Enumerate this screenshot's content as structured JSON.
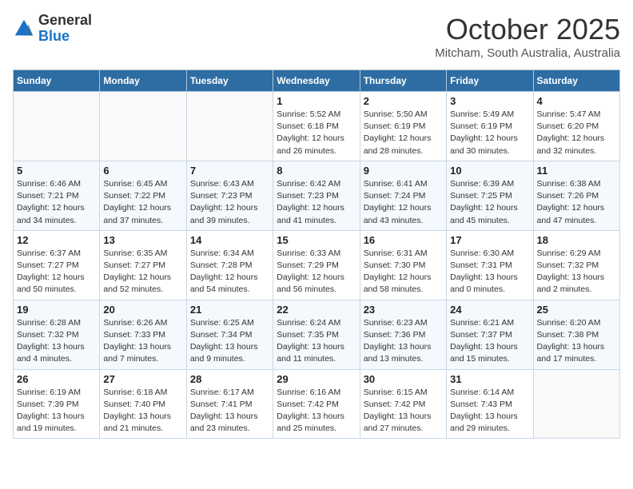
{
  "logo": {
    "general": "General",
    "blue": "Blue"
  },
  "title": "October 2025",
  "location": "Mitcham, South Australia, Australia",
  "days_of_week": [
    "Sunday",
    "Monday",
    "Tuesday",
    "Wednesday",
    "Thursday",
    "Friday",
    "Saturday"
  ],
  "weeks": [
    [
      {
        "day": "",
        "info": ""
      },
      {
        "day": "",
        "info": ""
      },
      {
        "day": "",
        "info": ""
      },
      {
        "day": "1",
        "info": "Sunrise: 5:52 AM\nSunset: 6:18 PM\nDaylight: 12 hours\nand 26 minutes."
      },
      {
        "day": "2",
        "info": "Sunrise: 5:50 AM\nSunset: 6:19 PM\nDaylight: 12 hours\nand 28 minutes."
      },
      {
        "day": "3",
        "info": "Sunrise: 5:49 AM\nSunset: 6:19 PM\nDaylight: 12 hours\nand 30 minutes."
      },
      {
        "day": "4",
        "info": "Sunrise: 5:47 AM\nSunset: 6:20 PM\nDaylight: 12 hours\nand 32 minutes."
      }
    ],
    [
      {
        "day": "5",
        "info": "Sunrise: 6:46 AM\nSunset: 7:21 PM\nDaylight: 12 hours\nand 34 minutes."
      },
      {
        "day": "6",
        "info": "Sunrise: 6:45 AM\nSunset: 7:22 PM\nDaylight: 12 hours\nand 37 minutes."
      },
      {
        "day": "7",
        "info": "Sunrise: 6:43 AM\nSunset: 7:23 PM\nDaylight: 12 hours\nand 39 minutes."
      },
      {
        "day": "8",
        "info": "Sunrise: 6:42 AM\nSunset: 7:23 PM\nDaylight: 12 hours\nand 41 minutes."
      },
      {
        "day": "9",
        "info": "Sunrise: 6:41 AM\nSunset: 7:24 PM\nDaylight: 12 hours\nand 43 minutes."
      },
      {
        "day": "10",
        "info": "Sunrise: 6:39 AM\nSunset: 7:25 PM\nDaylight: 12 hours\nand 45 minutes."
      },
      {
        "day": "11",
        "info": "Sunrise: 6:38 AM\nSunset: 7:26 PM\nDaylight: 12 hours\nand 47 minutes."
      }
    ],
    [
      {
        "day": "12",
        "info": "Sunrise: 6:37 AM\nSunset: 7:27 PM\nDaylight: 12 hours\nand 50 minutes."
      },
      {
        "day": "13",
        "info": "Sunrise: 6:35 AM\nSunset: 7:27 PM\nDaylight: 12 hours\nand 52 minutes."
      },
      {
        "day": "14",
        "info": "Sunrise: 6:34 AM\nSunset: 7:28 PM\nDaylight: 12 hours\nand 54 minutes."
      },
      {
        "day": "15",
        "info": "Sunrise: 6:33 AM\nSunset: 7:29 PM\nDaylight: 12 hours\nand 56 minutes."
      },
      {
        "day": "16",
        "info": "Sunrise: 6:31 AM\nSunset: 7:30 PM\nDaylight: 12 hours\nand 58 minutes."
      },
      {
        "day": "17",
        "info": "Sunrise: 6:30 AM\nSunset: 7:31 PM\nDaylight: 13 hours\nand 0 minutes."
      },
      {
        "day": "18",
        "info": "Sunrise: 6:29 AM\nSunset: 7:32 PM\nDaylight: 13 hours\nand 2 minutes."
      }
    ],
    [
      {
        "day": "19",
        "info": "Sunrise: 6:28 AM\nSunset: 7:32 PM\nDaylight: 13 hours\nand 4 minutes."
      },
      {
        "day": "20",
        "info": "Sunrise: 6:26 AM\nSunset: 7:33 PM\nDaylight: 13 hours\nand 7 minutes."
      },
      {
        "day": "21",
        "info": "Sunrise: 6:25 AM\nSunset: 7:34 PM\nDaylight: 13 hours\nand 9 minutes."
      },
      {
        "day": "22",
        "info": "Sunrise: 6:24 AM\nSunset: 7:35 PM\nDaylight: 13 hours\nand 11 minutes."
      },
      {
        "day": "23",
        "info": "Sunrise: 6:23 AM\nSunset: 7:36 PM\nDaylight: 13 hours\nand 13 minutes."
      },
      {
        "day": "24",
        "info": "Sunrise: 6:21 AM\nSunset: 7:37 PM\nDaylight: 13 hours\nand 15 minutes."
      },
      {
        "day": "25",
        "info": "Sunrise: 6:20 AM\nSunset: 7:38 PM\nDaylight: 13 hours\nand 17 minutes."
      }
    ],
    [
      {
        "day": "26",
        "info": "Sunrise: 6:19 AM\nSunset: 7:39 PM\nDaylight: 13 hours\nand 19 minutes."
      },
      {
        "day": "27",
        "info": "Sunrise: 6:18 AM\nSunset: 7:40 PM\nDaylight: 13 hours\nand 21 minutes."
      },
      {
        "day": "28",
        "info": "Sunrise: 6:17 AM\nSunset: 7:41 PM\nDaylight: 13 hours\nand 23 minutes."
      },
      {
        "day": "29",
        "info": "Sunrise: 6:16 AM\nSunset: 7:42 PM\nDaylight: 13 hours\nand 25 minutes."
      },
      {
        "day": "30",
        "info": "Sunrise: 6:15 AM\nSunset: 7:42 PM\nDaylight: 13 hours\nand 27 minutes."
      },
      {
        "day": "31",
        "info": "Sunrise: 6:14 AM\nSunset: 7:43 PM\nDaylight: 13 hours\nand 29 minutes."
      },
      {
        "day": "",
        "info": ""
      }
    ]
  ]
}
